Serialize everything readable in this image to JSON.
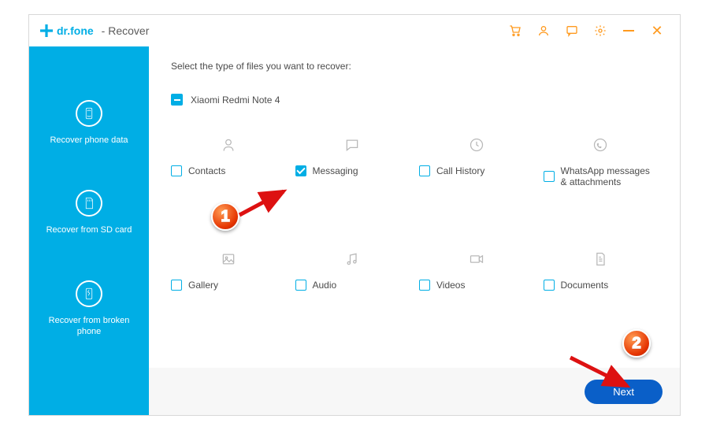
{
  "brand": "dr.fone",
  "module": "- Recover",
  "sidebar": {
    "items": [
      {
        "label": "Recover phone data"
      },
      {
        "label": "Recover from SD card"
      },
      {
        "label": "Recover from broken phone"
      }
    ]
  },
  "main": {
    "instruction": "Select the type of files you want to recover:",
    "device": "Xiaomi Redmi Note 4",
    "types": [
      {
        "label": "Contacts",
        "checked": false
      },
      {
        "label": "Messaging",
        "checked": true
      },
      {
        "label": "Call History",
        "checked": false
      },
      {
        "label": "WhatsApp messages & attachments",
        "checked": false
      },
      {
        "label": "Gallery",
        "checked": false
      },
      {
        "label": "Audio",
        "checked": false
      },
      {
        "label": "Videos",
        "checked": false
      },
      {
        "label": "Documents",
        "checked": false
      }
    ],
    "next": "Next"
  },
  "annotations": {
    "step1": "1",
    "step2": "2"
  }
}
